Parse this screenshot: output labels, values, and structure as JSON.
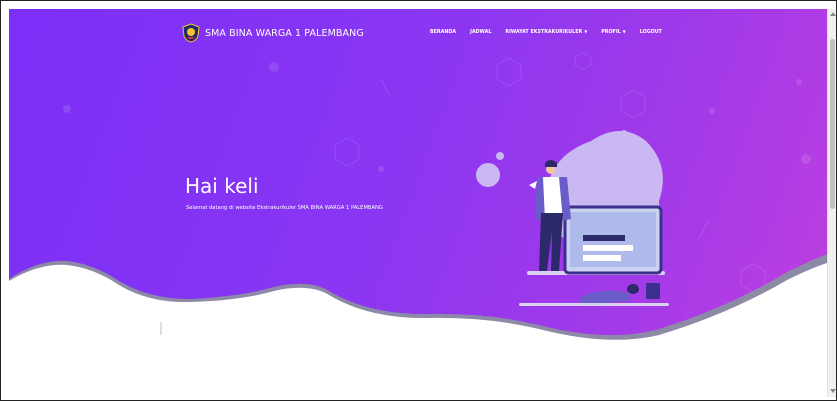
{
  "navbar": {
    "brand": "SMA BINA WARGA 1 PALEMBANG",
    "logo_icon": "school-emblem-icon",
    "items": [
      {
        "label": "BERANDA",
        "dropdown": false
      },
      {
        "label": "JADWAL",
        "dropdown": false
      },
      {
        "label": "RIWAYAT EKSTRAKURIKULER",
        "dropdown": true
      },
      {
        "label": "PROFIL",
        "dropdown": true
      },
      {
        "label": "LOGOUT",
        "dropdown": false
      }
    ]
  },
  "hero": {
    "greeting": "Hai keli",
    "subtitle": "Selamat datang di website Ekstrakurikuler SMA BINA WARGA 1 PALEMBANG",
    "illustration": "person-with-laptop-illustration",
    "gradient_start": "#7b2ff7",
    "gradient_end": "#c13fe0"
  }
}
